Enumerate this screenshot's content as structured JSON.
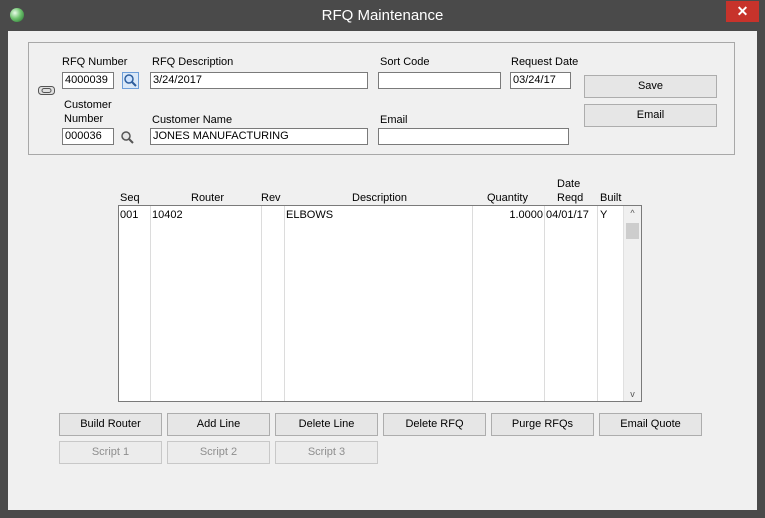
{
  "window": {
    "title": "RFQ Maintenance",
    "close_glyph": "✕"
  },
  "header": {
    "rfq_number": {
      "label": "RFQ Number",
      "value": "4000039"
    },
    "rfq_description": {
      "label": "RFQ Description",
      "value": "3/24/2017"
    },
    "sort_code": {
      "label": "Sort Code",
      "value": ""
    },
    "request_date": {
      "label": "Request Date",
      "value": "03/24/17"
    },
    "customer_number": {
      "label_line1": "Customer",
      "label_line2": "Number",
      "value": "000036"
    },
    "customer_name": {
      "label": "Customer Name",
      "value": "JONES MANUFACTURING"
    },
    "email": {
      "label": "Email",
      "value": ""
    }
  },
  "side_buttons": {
    "save": "Save",
    "email": "Email"
  },
  "grid": {
    "headers": {
      "seq": "Seq",
      "router": "Router",
      "rev": "Rev",
      "description": "Description",
      "quantity": "Quantity",
      "date_line1": "Date",
      "date_line2": "Reqd",
      "built": "Built"
    },
    "rows": [
      {
        "seq": "001",
        "router": "10402",
        "rev": "",
        "description": "ELBOWS",
        "quantity": "1.0000",
        "date_reqd": "04/01/17",
        "built": "Y"
      }
    ]
  },
  "scroll": {
    "up_glyph": "^",
    "down_glyph": "v"
  },
  "action_buttons": {
    "build_router": "Build Router",
    "add_line": "Add Line",
    "delete_line": "Delete Line",
    "delete_rfq": "Delete RFQ",
    "purge_rfqs": "Purge RFQs",
    "email_quote": "Email Quote"
  },
  "script_buttons": {
    "script1": "Script 1",
    "script2": "Script 2",
    "script3": "Script 3"
  },
  "icons": {
    "app": "app-globe-icon",
    "attach": "attachment-icon",
    "lookup": "magnifier-icon"
  }
}
